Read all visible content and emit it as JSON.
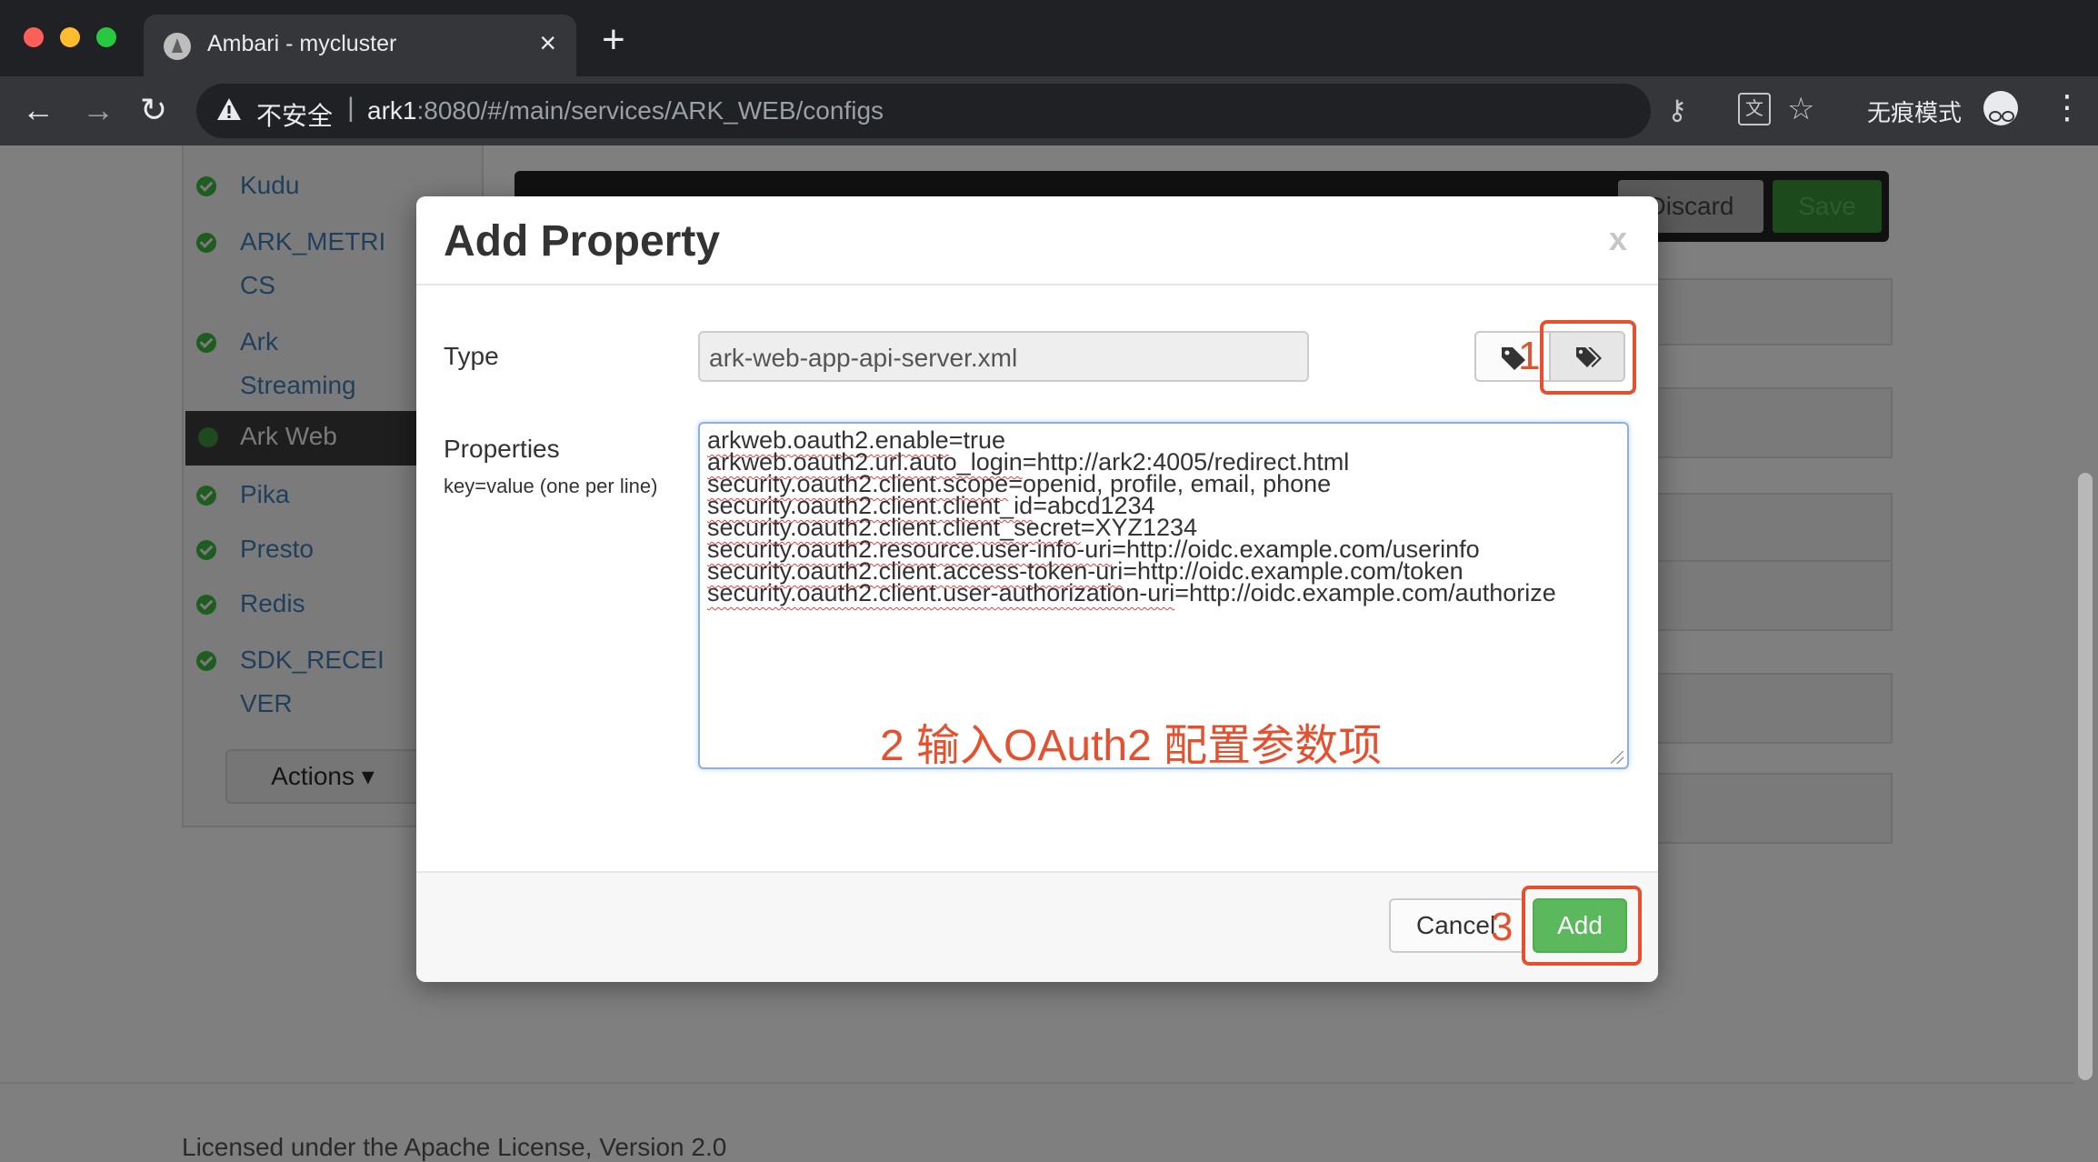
{
  "browser": {
    "tab_title": "Ambari - mycluster",
    "new_tab_symbol": "+",
    "tab_close_symbol": "×",
    "security_label": "不安全",
    "url_host": "ark1",
    "url_rest": ":8080/#/main/services/ARK_WEB/configs",
    "incognito_label": "无痕模式",
    "icons": [
      "back-icon",
      "forward-icon",
      "reload-icon",
      "warning-icon",
      "key-icon",
      "translate-icon",
      "star-icon",
      "incognito-icon",
      "more-icon"
    ]
  },
  "sidebar": {
    "services": [
      {
        "name": "Kudu"
      },
      {
        "name": "ARK_METRI"
      },
      {
        "name": "CS"
      },
      {
        "name": "Ark"
      },
      {
        "name": "Streaming"
      },
      {
        "name": "Ark Web"
      },
      {
        "name": "Pika"
      },
      {
        "name": "Presto"
      },
      {
        "name": "Redis"
      },
      {
        "name": "SDK_RECEI"
      },
      {
        "name": "VER"
      }
    ],
    "actions_label": "Actions"
  },
  "config_toolbar": {
    "discard_label": "Discard",
    "save_label": "Save"
  },
  "footer": {
    "license_text": "Licensed under the Apache License, Version 2.0"
  },
  "modal": {
    "title": "Add Property",
    "close_label": "x",
    "type_label": "Type",
    "type_value": "ark-web-app-api-server.xml",
    "properties_label": "Properties",
    "properties_hint": "key=value (one per line)",
    "properties": [
      {
        "key": "arkweb.oauth2.enable",
        "value": "true"
      },
      {
        "key": "arkweb.oauth2.url.auto_login",
        "value": "http://ark2:4005/redirect.html"
      },
      {
        "key": "security.oauth2.client.scope",
        "value": "openid, profile, email, phone"
      },
      {
        "key": "security.oauth2.client.client_id",
        "value": "abcd1234"
      },
      {
        "key": "security.oauth2.client.client_secret",
        "value": "XYZ1234"
      },
      {
        "key": "security.oauth2.resource.user-info-uri",
        "value": "http://oidc.example.com/userinfo"
      },
      {
        "key": "security.oauth2.client.access-token-uri",
        "value": "http://oidc.example.com/token"
      },
      {
        "key": "security.oauth2.client.user-authorization-uri",
        "value": "http://oidc.example.com/authorize"
      }
    ],
    "cancel_label": "Cancel",
    "add_label": "Add"
  },
  "annotations": {
    "step1": "1",
    "step2": "2 输入OAuth2 配置参数项",
    "step3": "3",
    "color": "#e5502f"
  }
}
